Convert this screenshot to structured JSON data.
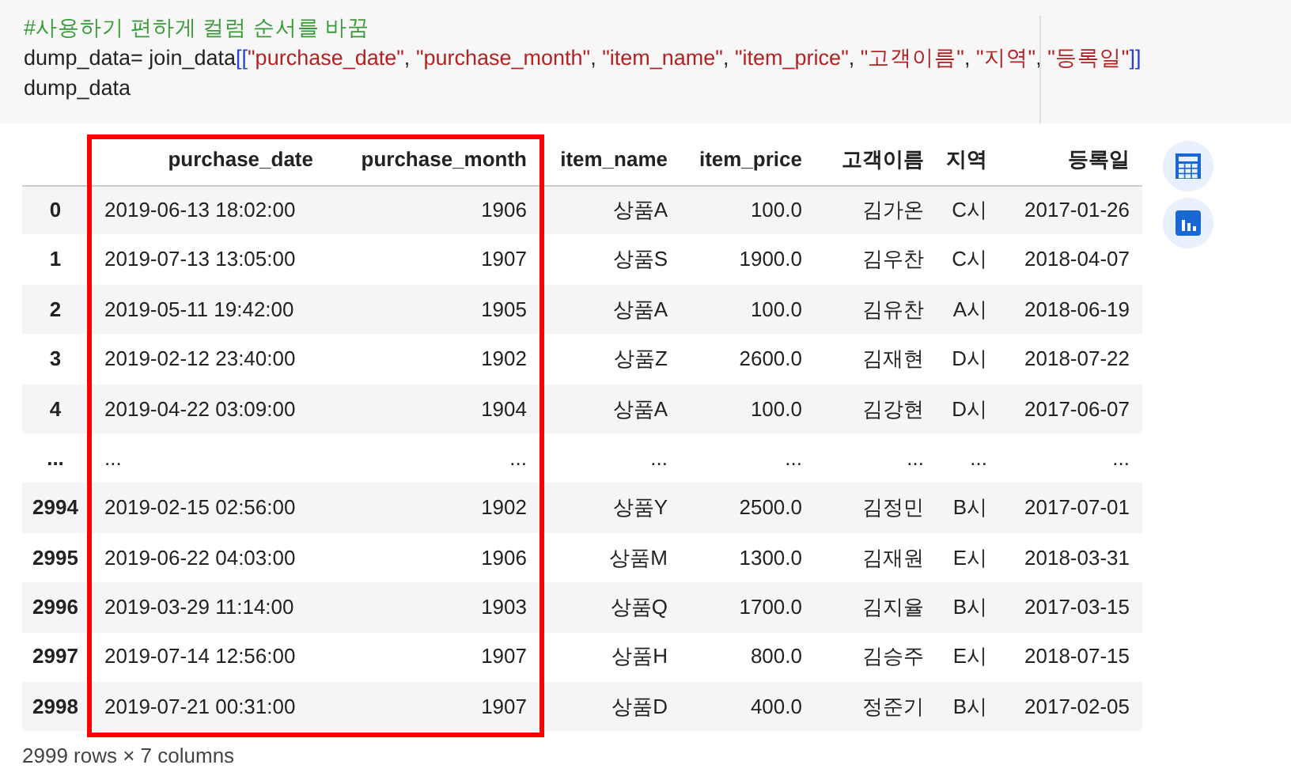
{
  "code_cell": {
    "lines": [
      {
        "tokens": [
          {
            "kind": "comment",
            "text": "#사용하기 편하게 컬럼 순서를 바꿈"
          }
        ]
      },
      {
        "tokens": [
          {
            "kind": "plain",
            "text": "dump_data= join_data"
          },
          {
            "kind": "bracket",
            "text": "[["
          },
          {
            "kind": "string",
            "text": "\"purchase_date\""
          },
          {
            "kind": "plain",
            "text": ", "
          },
          {
            "kind": "string",
            "text": "\"purchase_month\""
          },
          {
            "kind": "plain",
            "text": ", "
          },
          {
            "kind": "string",
            "text": "\"item_name\""
          },
          {
            "kind": "plain",
            "text": ", "
          },
          {
            "kind": "string",
            "text": "\"item_price\""
          },
          {
            "kind": "plain",
            "text": ", "
          },
          {
            "kind": "string",
            "text": "\"고객이름\""
          },
          {
            "kind": "plain",
            "text": ", "
          },
          {
            "kind": "string",
            "text": "\"지역\""
          },
          {
            "kind": "plain",
            "text": ", "
          },
          {
            "kind": "string",
            "text": "\"등록일\""
          },
          {
            "kind": "bracket",
            "text": "]]"
          }
        ]
      },
      {
        "tokens": [
          {
            "kind": "plain",
            "text": "dump_data"
          }
        ]
      }
    ]
  },
  "table": {
    "columns": [
      {
        "label": "purchase_date",
        "highlighted": true
      },
      {
        "label": "purchase_month",
        "highlighted": true
      },
      {
        "label": "item_name",
        "highlighted": false
      },
      {
        "label": "item_price",
        "highlighted": false
      },
      {
        "label": "고객이름",
        "highlighted": false
      },
      {
        "label": "지역",
        "highlighted": false
      },
      {
        "label": "등록일",
        "highlighted": false
      }
    ],
    "rows": [
      {
        "index": "0",
        "cells": [
          "2019-06-13 18:02:00",
          "1906",
          "상품A",
          "100.0",
          "김가온",
          "C시",
          "2017-01-26"
        ]
      },
      {
        "index": "1",
        "cells": [
          "2019-07-13 13:05:00",
          "1907",
          "상품S",
          "1900.0",
          "김우찬",
          "C시",
          "2018-04-07"
        ]
      },
      {
        "index": "2",
        "cells": [
          "2019-05-11 19:42:00",
          "1905",
          "상품A",
          "100.0",
          "김유찬",
          "A시",
          "2018-06-19"
        ]
      },
      {
        "index": "3",
        "cells": [
          "2019-02-12 23:40:00",
          "1902",
          "상품Z",
          "2600.0",
          "김재현",
          "D시",
          "2018-07-22"
        ]
      },
      {
        "index": "4",
        "cells": [
          "2019-04-22 03:09:00",
          "1904",
          "상품A",
          "100.0",
          "김강현",
          "D시",
          "2017-06-07"
        ]
      },
      {
        "index": "...",
        "cells": [
          "...",
          "...",
          "...",
          "...",
          "...",
          "...",
          "..."
        ]
      },
      {
        "index": "2994",
        "cells": [
          "2019-02-15 02:56:00",
          "1902",
          "상품Y",
          "2500.0",
          "김정민",
          "B시",
          "2017-07-01"
        ]
      },
      {
        "index": "2995",
        "cells": [
          "2019-06-22 04:03:00",
          "1906",
          "상품M",
          "1300.0",
          "김재원",
          "E시",
          "2018-03-31"
        ]
      },
      {
        "index": "2996",
        "cells": [
          "2019-03-29 11:14:00",
          "1903",
          "상품Q",
          "1700.0",
          "김지율",
          "B시",
          "2017-03-15"
        ]
      },
      {
        "index": "2997",
        "cells": [
          "2019-07-14 12:56:00",
          "1907",
          "상품H",
          "800.0",
          "김승주",
          "E시",
          "2018-07-15"
        ]
      },
      {
        "index": "2998",
        "cells": [
          "2019-07-21 00:31:00",
          "1907",
          "상품D",
          "400.0",
          "정준기",
          "B시",
          "2017-02-05"
        ]
      }
    ],
    "footer": "2999 rows × 7 columns"
  }
}
